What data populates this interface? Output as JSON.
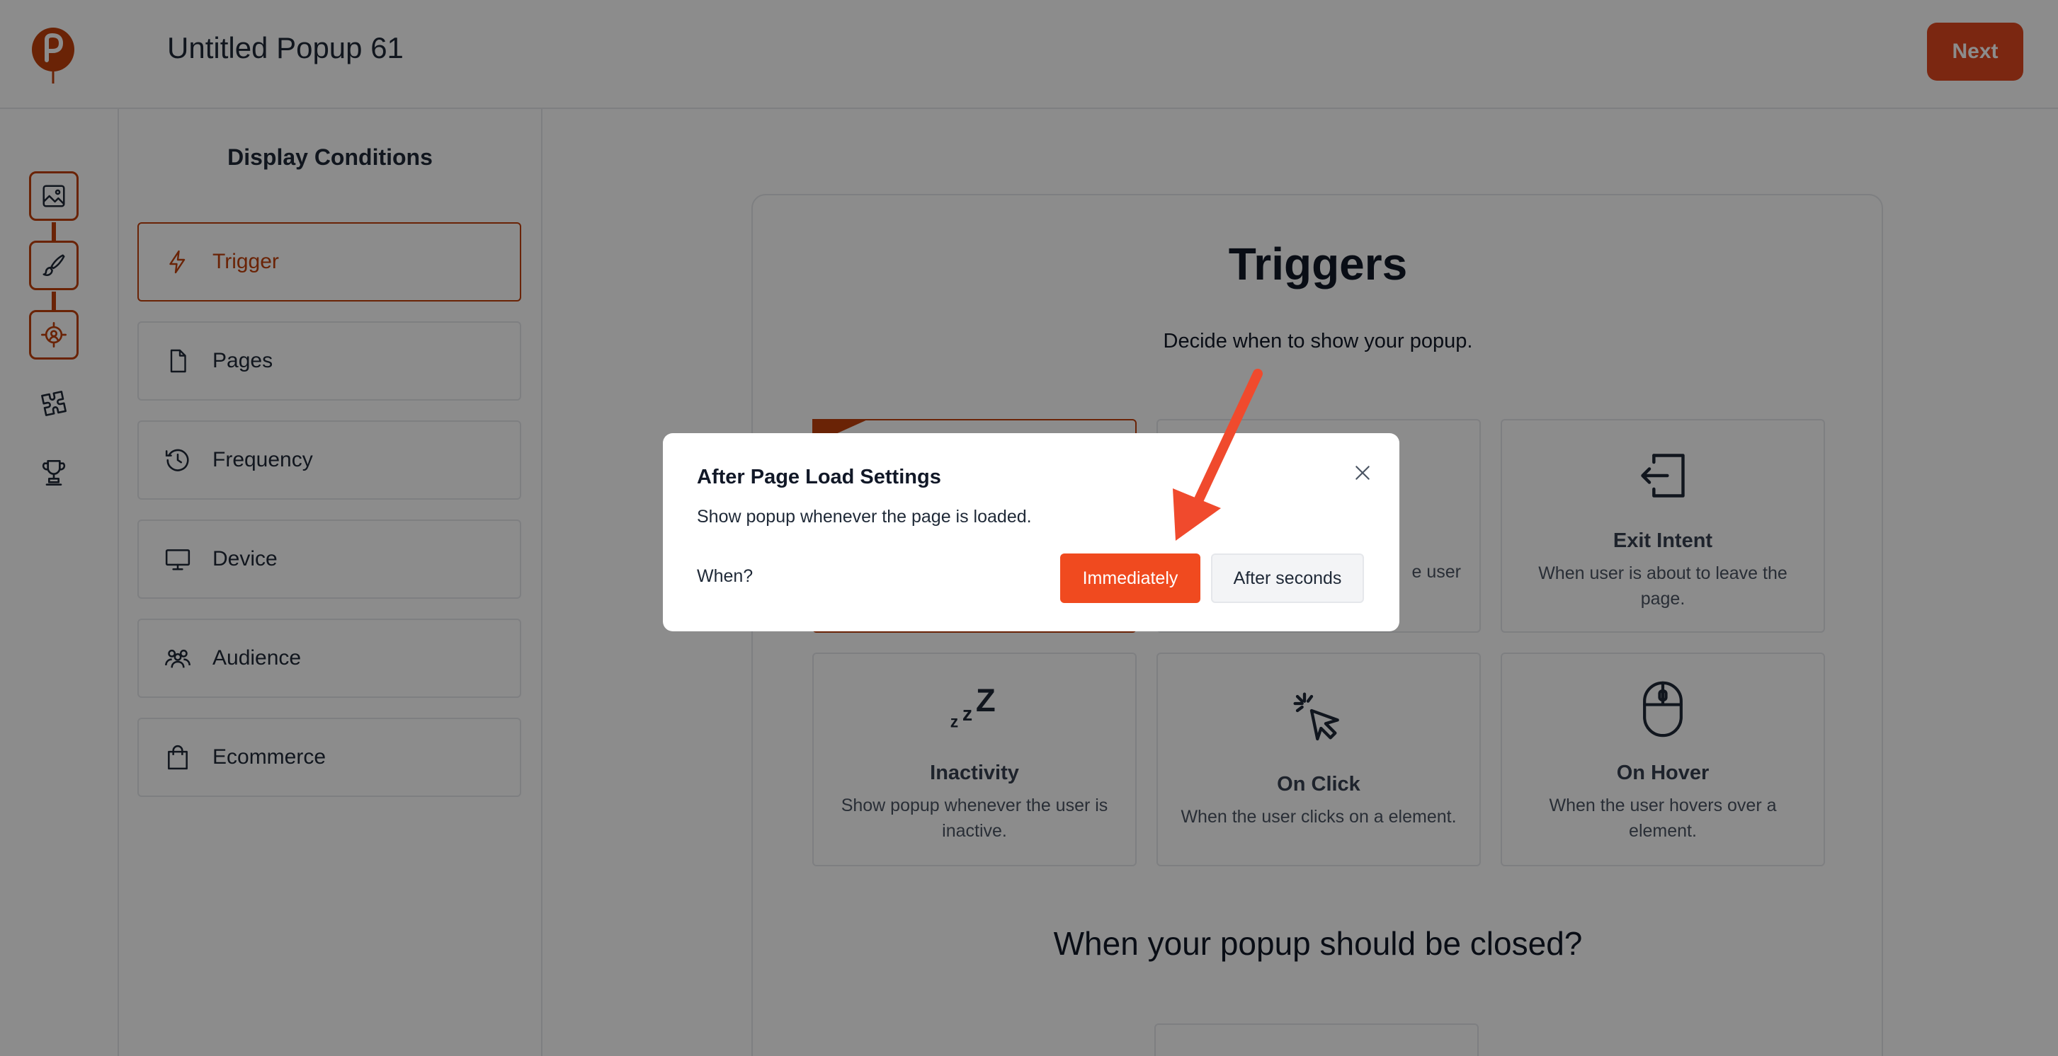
{
  "header": {
    "title": "Untitled Popup 61",
    "next_label": "Next"
  },
  "rail": {
    "items": [
      {
        "icon": "image-icon"
      },
      {
        "icon": "brush-icon"
      },
      {
        "icon": "target-icon"
      },
      {
        "icon": "puzzle-icon"
      },
      {
        "icon": "trophy-icon"
      }
    ]
  },
  "conditions": {
    "title": "Display Conditions",
    "items": [
      {
        "label": "Trigger",
        "icon": "bolt-icon",
        "active": true
      },
      {
        "label": "Pages",
        "icon": "file-icon"
      },
      {
        "label": "Frequency",
        "icon": "clock-icon"
      },
      {
        "label": "Device",
        "icon": "monitor-icon"
      },
      {
        "label": "Audience",
        "icon": "users-icon"
      },
      {
        "label": "Ecommerce",
        "icon": "shopping-bag-icon"
      }
    ]
  },
  "triggers": {
    "title": "Triggers",
    "subtitle": "Decide when to show your popup.",
    "partial_desc_tail": "e user",
    "cards": [
      {
        "name": "Exit Intent",
        "desc": "When user is about to leave the page.",
        "icon": "exit-icon"
      },
      {
        "name": "Inactivity",
        "desc": "Show popup whenever the user is inactive.",
        "icon": "sleep-icon"
      },
      {
        "name": "On Click",
        "desc": "When the user clicks on a element.",
        "icon": "cursor-click-icon"
      },
      {
        "name": "On Hover",
        "desc": "When the user hovers over a element.",
        "icon": "mouse-icon"
      }
    ],
    "close_title": "When your popup should be closed?"
  },
  "modal": {
    "title": "After Page Load Settings",
    "description": "Show popup whenever the page is loaded.",
    "when_label": "When?",
    "option_immediately": "Immediately",
    "option_after_seconds": "After seconds",
    "selected": "Immediately"
  },
  "colors": {
    "brand": "#c2410c",
    "primary_button": "#f04a1f",
    "arrow": "#f04a2d"
  }
}
